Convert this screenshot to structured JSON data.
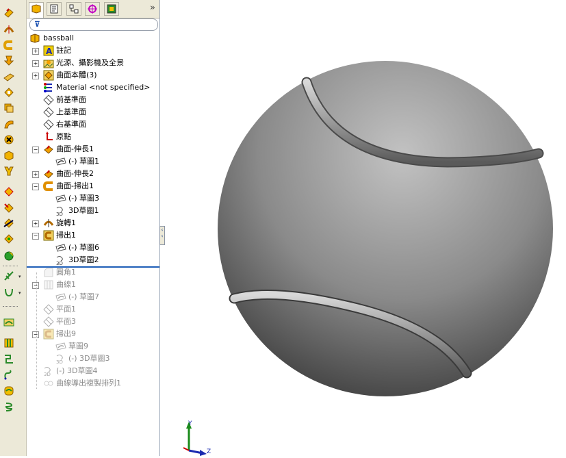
{
  "feature_tree": {
    "root": "bassball",
    "items": [
      {
        "label": "註記",
        "pm": "+",
        "icon": "annotation-icon",
        "dim": false
      },
      {
        "label": "光源、攝影機及全景",
        "pm": "+",
        "icon": "lights-icon",
        "dim": false
      },
      {
        "label": "曲面本體(3)",
        "pm": "+",
        "icon": "surface-bodies-icon",
        "dim": false
      },
      {
        "label": "Material <not specified>",
        "pm": "",
        "icon": "material-icon",
        "dim": false
      },
      {
        "label": "前基準面",
        "pm": "",
        "icon": "plane-icon",
        "dim": false
      },
      {
        "label": "上基準面",
        "pm": "",
        "icon": "plane-icon",
        "dim": false
      },
      {
        "label": "右基準面",
        "pm": "",
        "icon": "plane-icon",
        "dim": false
      },
      {
        "label": "原點",
        "pm": "",
        "icon": "origin-icon",
        "dim": false
      },
      {
        "label": "曲面-伸長1",
        "pm": "−",
        "icon": "surface-extrude-icon",
        "dim": false
      },
      {
        "label": "(-) 草圖1",
        "pm": "",
        "icon": "sketch-icon",
        "dim": false,
        "child": true
      },
      {
        "label": "曲面-伸長2",
        "pm": "+",
        "icon": "surface-extrude-icon",
        "dim": false
      },
      {
        "label": "曲面-掃出1",
        "pm": "−",
        "icon": "surface-sweep-icon",
        "dim": false
      },
      {
        "label": "(-) 草圖3",
        "pm": "",
        "icon": "sketch-icon",
        "dim": false,
        "child": true
      },
      {
        "label": "3D草圖1",
        "pm": "",
        "icon": "3dsketch-icon",
        "dim": false,
        "child": true
      },
      {
        "label": "旋轉1",
        "pm": "+",
        "icon": "revolve-icon",
        "dim": false
      },
      {
        "label": "掃出1",
        "pm": "−",
        "icon": "sweep-icon",
        "dim": false
      },
      {
        "label": "(-) 草圖6",
        "pm": "",
        "icon": "sketch-icon",
        "dim": false,
        "child": true
      },
      {
        "label": "3D草圖2",
        "pm": "",
        "icon": "3dsketch-icon",
        "dim": false,
        "child": true
      },
      {
        "label": "圓角1",
        "pm": "",
        "icon": "fillet-icon",
        "dim": true
      },
      {
        "label": "曲線1",
        "pm": "−",
        "icon": "curve-icon",
        "dim": true
      },
      {
        "label": "(-) 草圖7",
        "pm": "",
        "icon": "sketch-icon",
        "dim": true,
        "child": true
      },
      {
        "label": "平面1",
        "pm": "",
        "icon": "plane-icon",
        "dim": true
      },
      {
        "label": "平面3",
        "pm": "",
        "icon": "plane-icon",
        "dim": true
      },
      {
        "label": "掃出9",
        "pm": "−",
        "icon": "sweep-icon",
        "dim": true
      },
      {
        "label": "草圖9",
        "pm": "",
        "icon": "sketch-icon",
        "dim": true,
        "child": true
      },
      {
        "label": "(-) 3D草圖3",
        "pm": "",
        "icon": "3dsketch-icon",
        "dim": true,
        "child": true
      },
      {
        "label": "(-) 3D草圖4",
        "pm": "",
        "icon": "3dsketch-icon",
        "dim": true
      },
      {
        "label": "曲線導出複製排列1",
        "pm": "",
        "icon": "pattern-icon",
        "dim": true
      }
    ]
  },
  "tabs": [
    "feature-manager-tab",
    "property-manager-tab",
    "configuration-manager-tab",
    "dimxpert-tab",
    "display-manager-tab"
  ],
  "triad": {
    "y": "Y",
    "z": "Z"
  },
  "colors": {
    "accent": "#1f5fb8",
    "toolbar_bg": "#ece9d8",
    "plus_border": "#919191",
    "dim_text": "#8c8c8c"
  }
}
